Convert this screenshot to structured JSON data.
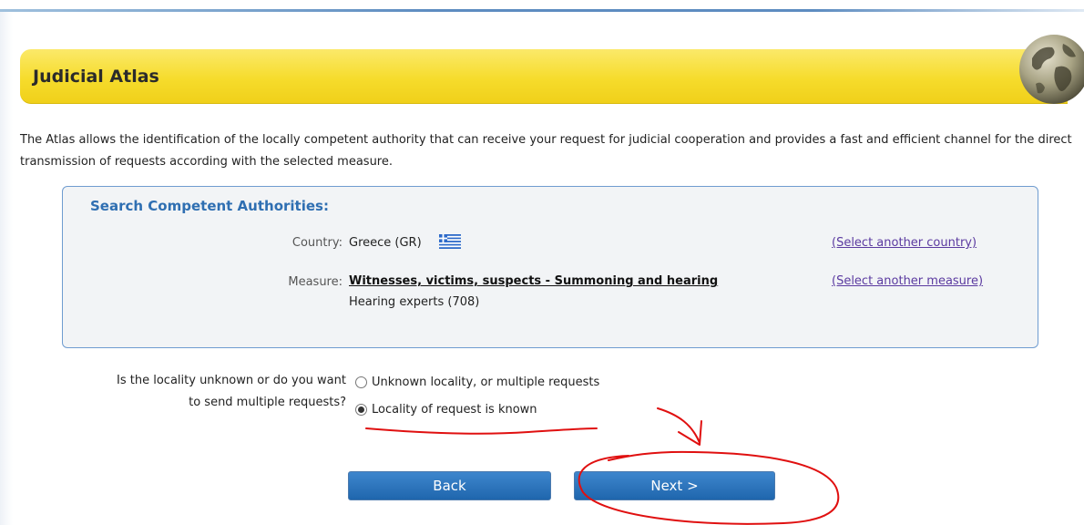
{
  "header": {
    "title": "Judicial Atlas"
  },
  "intro": "The Atlas allows the identification of the locally competent authority that can receive your request for judicial cooperation and provides a fast and efficient channel for the direct transmission of requests according with the selected measure.",
  "search": {
    "title": "Search Competent Authorities:",
    "country_label": "Country:",
    "country_value": "Greece (GR)",
    "country_flag": "greece-flag-icon",
    "select_country_link": "(Select another country)",
    "measure_label": "Measure:",
    "measure_value": "Witnesses, victims, suspects - Summoning and hearing",
    "measure_sub": "Hearing experts (708)",
    "select_measure_link": "(Select another measure)"
  },
  "locality": {
    "question_line1": "Is the locality unknown or do you want",
    "question_line2": "to send multiple requests?",
    "options": [
      {
        "label": "Unknown locality, or multiple requests",
        "checked": false
      },
      {
        "label": "Locality of request is known",
        "checked": true
      }
    ]
  },
  "buttons": {
    "back": "Back",
    "next": "Next >"
  },
  "colors": {
    "header_yellow": "#f6dc2c",
    "title_blue": "#2f6fb2",
    "button_blue": "#1f66ad",
    "link_purple": "#5b3aa0",
    "annotation_red": "#e01010"
  }
}
